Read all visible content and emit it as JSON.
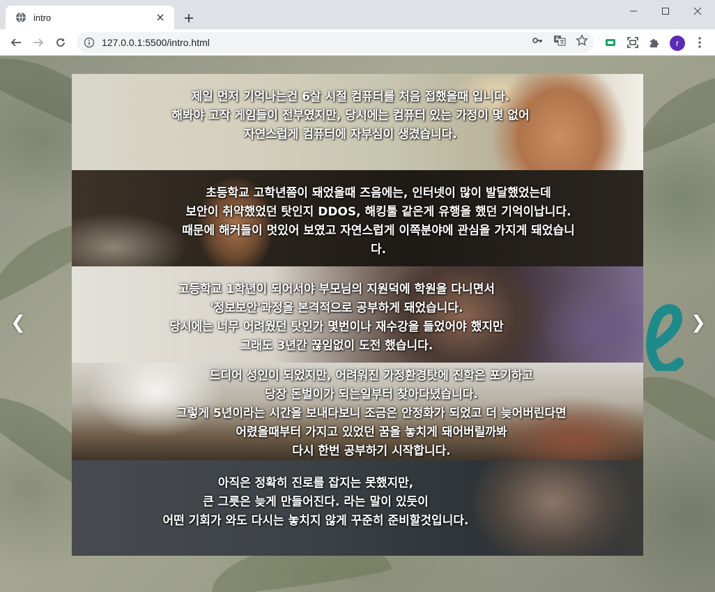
{
  "browser": {
    "tab_title": "intro",
    "url": "127.0.0.1:5500/intro.html",
    "profile_initial": "r",
    "accent_color": "#5b2bb5"
  },
  "icons": [
    "globe-icon",
    "close-icon",
    "plus-icon",
    "minimize-icon",
    "maximize-icon",
    "window-close-icon",
    "back-icon",
    "forward-icon",
    "reload-icon",
    "info-icon",
    "key-icon",
    "translate-icon",
    "star-icon",
    "extension-icon",
    "screen-capture-icon",
    "puzzle-icon",
    "kebab-menu-icon"
  ],
  "carousel": {
    "prev_label": "❮",
    "next_label": "❯"
  },
  "sections": [
    {
      "lines": [
        "제일 먼저 기억나는건 6살 시절 컴퓨터를 처음 접했을때 입니다.",
        "해봐야 고작 게임들이 전부였지만, 당시에는 컴퓨터 있는 가정이 몇 없어",
        "자연스럽게 컴퓨터에 자부심이 생겼습니다."
      ]
    },
    {
      "lines": [
        "초등학교 고학년쯤이 돼었을때 즈음에는, 인터넷이 많이 발달했었는데",
        "보안이 취약했었던 탓인지 DDOS, 해킹툴 같은게 유행을 했던 기억이납니다.",
        "때문에 해커들이 멋있어 보였고 자연스럽게 이쪽분야에 관심을 가지게 돼었습니",
        "다."
      ]
    },
    {
      "lines": [
        "고등학교 1학년이 되어서야 부모님의 지원덕에 학원을 다니면서",
        "'정보보안'과정을 본격적으로 공부하게 돼었습니다.",
        "당시에는 너무 어려웠던 탓인가 몇번이나 재수강을 들었어야 했지만",
        "그래도 3년간 끊임없이 도전 했습니다."
      ]
    },
    {
      "lines": [
        "드디어 성인이 되었지만, 어려워진 가정환경탓에 진학은 포기하고",
        "당장 돈벌이가 되는일부터 찾아다녔습니다.",
        "그렇게 5년이라는 시간을 보내다보니 조금은 안정화가 되었고 더 늦어버린다면",
        "어렸을때부터 가지고 있었던 꿈을 놓치게 돼어버릴까봐",
        "다시 한번 공부하기 시작합니다."
      ]
    },
    {
      "lines": [
        "아직은 정확히 진로를 잡지는 못했지만,",
        "큰 그릇은 늦게 만들어진다. 라는 말이 있듯이",
        "어떤 기회가 와도 다시는 놓치지 않게 꾸준히 준비할것입니다."
      ]
    }
  ]
}
